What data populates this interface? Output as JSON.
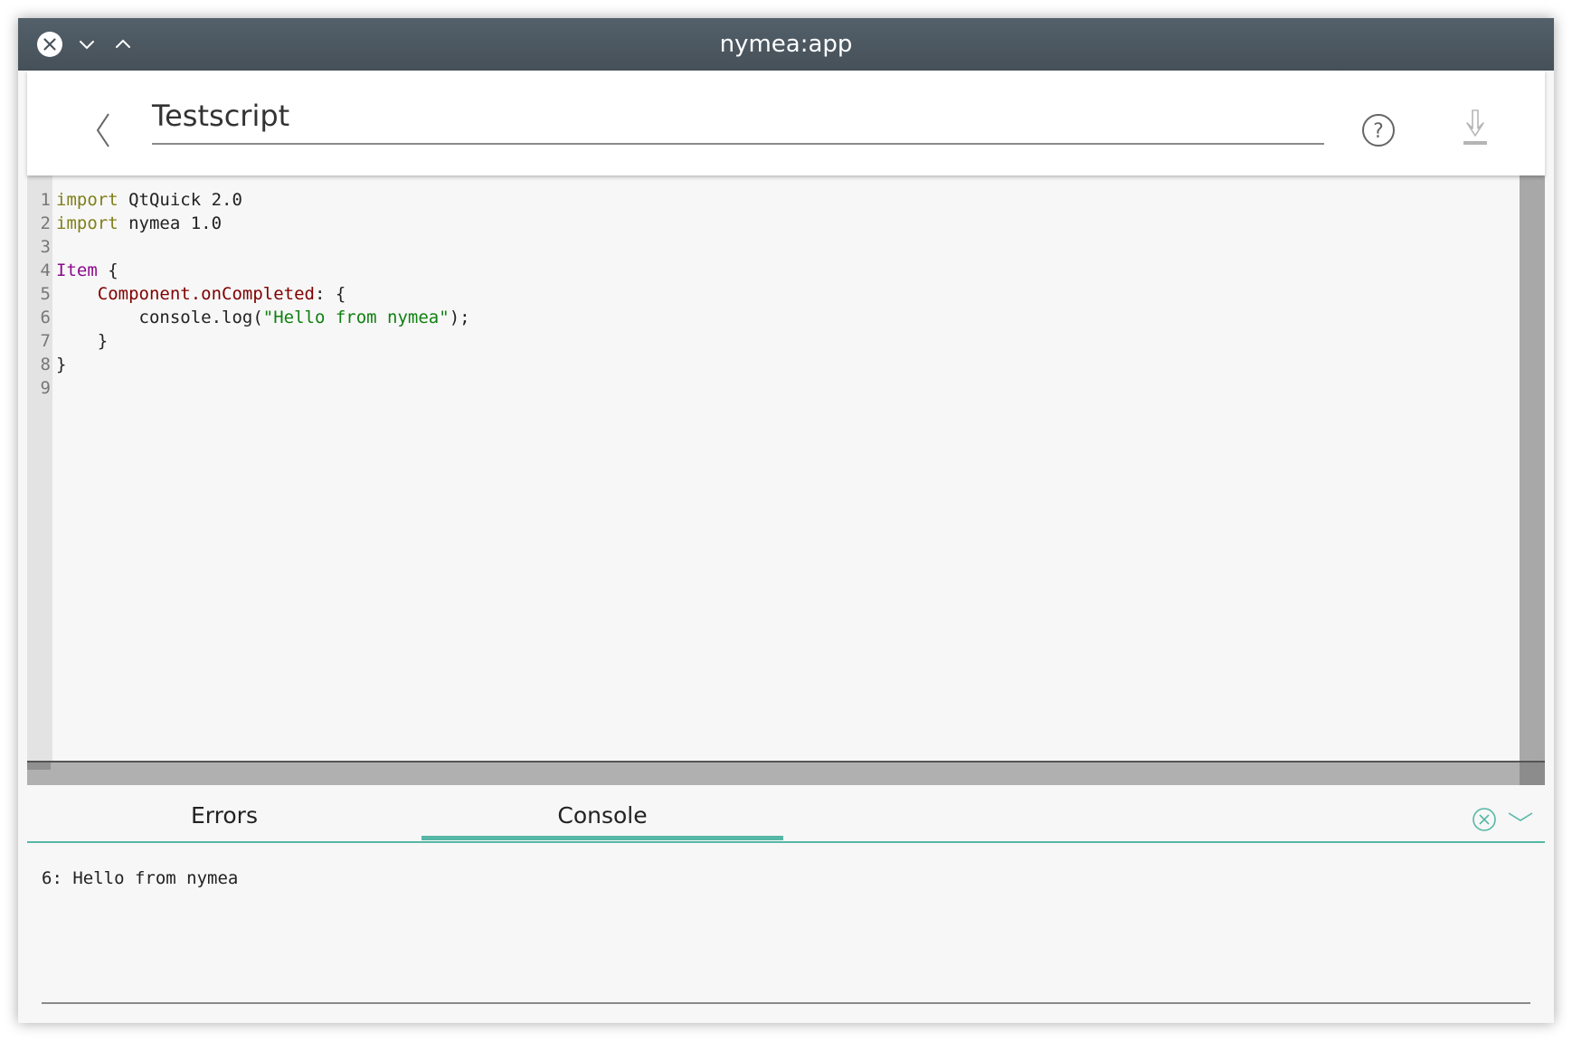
{
  "window": {
    "title": "nymea:app"
  },
  "header": {
    "script_name": "Testscript"
  },
  "editor": {
    "line_numbers": [
      "1",
      "2",
      "3",
      "4",
      "5",
      "6",
      "7",
      "8",
      "9"
    ],
    "lines": [
      [
        {
          "t": "import",
          "c": "kw"
        },
        {
          "t": " QtQuick 2.0",
          "c": ""
        }
      ],
      [
        {
          "t": "import",
          "c": "kw"
        },
        {
          "t": " nymea 1.0",
          "c": ""
        }
      ],
      [],
      [
        {
          "t": "Item",
          "c": "ty"
        },
        {
          "t": " {",
          "c": ""
        }
      ],
      [
        {
          "t": "    ",
          "c": ""
        },
        {
          "t": "Component.onCompleted",
          "c": "pr"
        },
        {
          "t": ": {",
          "c": ""
        }
      ],
      [
        {
          "t": "        console.log(",
          "c": ""
        },
        {
          "t": "\"Hello from nymea\"",
          "c": "st"
        },
        {
          "t": ");",
          "c": ""
        }
      ],
      [
        {
          "t": "    }",
          "c": ""
        }
      ],
      [
        {
          "t": "}",
          "c": ""
        }
      ],
      []
    ]
  },
  "panel": {
    "tabs": [
      {
        "label": "Errors",
        "selected": false
      },
      {
        "label": "Console",
        "selected": true
      }
    ],
    "console_output": "6: Hello from nymea",
    "accent_color": "#57b7a6"
  }
}
